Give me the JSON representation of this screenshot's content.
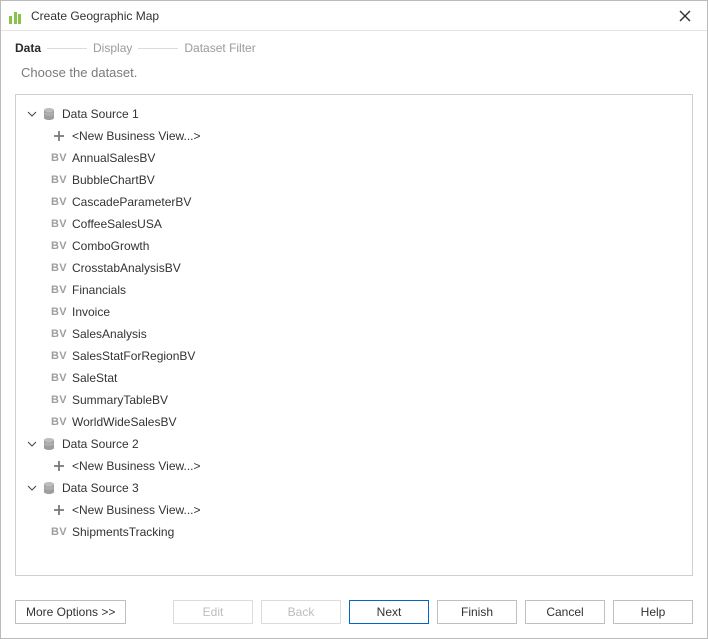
{
  "window": {
    "title": "Create Geographic Map"
  },
  "steps": {
    "data": "Data",
    "display": "Display",
    "datasetFilter": "Dataset Filter",
    "activeIndex": 0
  },
  "subheader": "Choose the dataset.",
  "tree": {
    "sources": [
      {
        "label": "Data Source 1",
        "expanded": true,
        "children": [
          {
            "type": "new",
            "label": "<New Business View...>"
          },
          {
            "type": "bv",
            "label": "AnnualSalesBV"
          },
          {
            "type": "bv",
            "label": "BubbleChartBV"
          },
          {
            "type": "bv",
            "label": "CascadeParameterBV"
          },
          {
            "type": "bv",
            "label": "CoffeeSalesUSA"
          },
          {
            "type": "bv",
            "label": "ComboGrowth"
          },
          {
            "type": "bv",
            "label": "CrosstabAnalysisBV"
          },
          {
            "type": "bv",
            "label": "Financials"
          },
          {
            "type": "bv",
            "label": "Invoice"
          },
          {
            "type": "bv",
            "label": "SalesAnalysis"
          },
          {
            "type": "bv",
            "label": "SalesStatForRegionBV"
          },
          {
            "type": "bv",
            "label": "SaleStat"
          },
          {
            "type": "bv",
            "label": "SummaryTableBV"
          },
          {
            "type": "bv",
            "label": "WorldWideSalesBV"
          }
        ]
      },
      {
        "label": "Data Source 2",
        "expanded": true,
        "children": [
          {
            "type": "new",
            "label": "<New Business View...>"
          }
        ]
      },
      {
        "label": "Data Source 3",
        "expanded": true,
        "children": [
          {
            "type": "new",
            "label": "<New Business View...>"
          },
          {
            "type": "bv",
            "label": "ShipmentsTracking"
          }
        ]
      }
    ]
  },
  "buttons": {
    "moreOptions": "More Options >>",
    "edit": "Edit",
    "back": "Back",
    "next": "Next",
    "finish": "Finish",
    "cancel": "Cancel",
    "help": "Help"
  },
  "iconGlyphs": {
    "bv": "BV"
  }
}
